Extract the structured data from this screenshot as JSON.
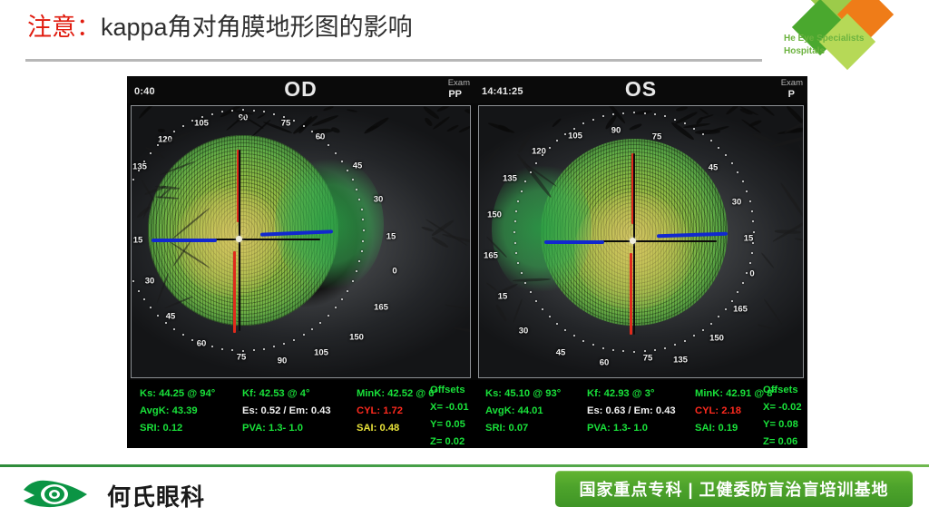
{
  "slide": {
    "title_accent": "注意：",
    "title_main": "kappa角对角膜地形图的影响"
  },
  "brand": {
    "line1": "He Eye Specialists",
    "line2": "Hospitals",
    "color_light_green": "#9ccb4a",
    "color_green": "#4aa82e",
    "color_orange": "#ef7c18",
    "color_pale_green": "#b6d957",
    "text_color": "#6cb33f"
  },
  "topography": {
    "od": {
      "time": "0:40",
      "eye_label": "OD",
      "exam_label": "Exam",
      "pp_label": "PP",
      "degrees": [
        "135",
        "120",
        "105",
        "90",
        "75",
        "60",
        "45",
        "30",
        "15",
        "0",
        "165",
        "150"
      ],
      "measurements": {
        "ks": "Ks: 44.25 @ 94°",
        "avgk": "AvgK: 43.39",
        "sri": "SRI: 0.12",
        "kf": "Kf: 42.53 @  4°",
        "es_em": "Es: 0.52 / Em: 0.43",
        "pva": "PVA:  1.3-  1.0",
        "mink": "MinK: 42.52 @  6°",
        "cyl": "CYL:  1.72",
        "sai": "SAI: 0.48",
        "offsets_title": "Offsets",
        "offset_x": "X= -0.01",
        "offset_y": "Y=  0.05",
        "offset_z": "Z=  0.02"
      }
    },
    "os": {
      "time": "14:41:25",
      "eye_label": "OS",
      "exam_label": "Exam",
      "pp_label": "P",
      "degrees": [
        "135",
        "120",
        "105",
        "90",
        "75",
        "60",
        "45",
        "30",
        "15",
        "0",
        "165",
        "150"
      ],
      "measurements": {
        "ks": "Ks: 45.10 @ 93°",
        "avgk": "AvgK: 44.01",
        "sri": "SRI: 0.07",
        "kf": "Kf: 42.93 @  3°",
        "es_em": "Es: 0.63 / Em: 0.43",
        "pva": "PVA:  1.3-  1.0",
        "mink": "MinK: 42.91 @  8°",
        "cyl": "CYL:  2.18",
        "sai": "SAI: 0.19",
        "offsets_title": "Offsets",
        "offset_x": "X= -0.02",
        "offset_y": "Y=  0.08",
        "offset_z": "Z=  0.06"
      }
    },
    "colors": {
      "steep_axis": "#e02a1c",
      "flat_axis": "#0b0b0b",
      "offset_marker": "#1128cf",
      "value_green": "#19e13a",
      "value_red": "#ff2a1e",
      "value_yellow": "#e8e23a"
    }
  },
  "footer": {
    "logo_text": "何氏眼科",
    "banner_text": "国家重点专科 | 卫健委防盲治盲培训基地",
    "banner_color": "#4da32b",
    "rule_color": "#3f9b46"
  }
}
